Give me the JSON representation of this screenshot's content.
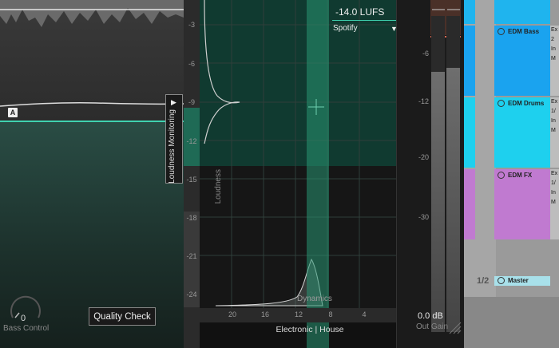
{
  "plugin": {
    "marker_label": "A",
    "monitor_tab": {
      "arrow": "▶",
      "label": "Loudness Monitoring"
    },
    "bass_control": {
      "value": "0",
      "label": "Bass Control"
    },
    "quality_check_label": "Quality Check"
  },
  "loudness": {
    "target": "-14.0 LUFS",
    "platform": "Spotify",
    "platform_arrow": "▼",
    "y_ticks": [
      "-3",
      "-6",
      "-9",
      "-12",
      "-15",
      "-18",
      "-21",
      "-24"
    ],
    "y_axis_label": "Loudness",
    "x_ticks": [
      "20",
      "16",
      "12",
      "8",
      "4"
    ],
    "x_axis_label": "Dynamics",
    "genre": "Electronic | House"
  },
  "meter": {
    "ticks": [
      "-6",
      "-12",
      "-20",
      "-30"
    ],
    "out_gain_value": "0.0 dB",
    "out_gain_label": "Out Gain"
  },
  "daw": {
    "tracks": [
      {
        "name": "EDM Bass",
        "color": "#1aa3ef",
        "side": [
          "Ex",
          "2",
          "In",
          "M"
        ]
      },
      {
        "name": "EDM Drums",
        "color": "#1ed0ee",
        "side": [
          "Ex",
          "1/",
          "In",
          "M"
        ]
      },
      {
        "name": "EDM FX",
        "color": "#c07ad0",
        "side": [
          "Ex",
          "1/",
          "In",
          "M"
        ]
      }
    ],
    "fraction": "1/2",
    "master_label": "Master"
  },
  "colors": {
    "accent": "#3fd2b0",
    "teal_dark": "#103a30"
  }
}
